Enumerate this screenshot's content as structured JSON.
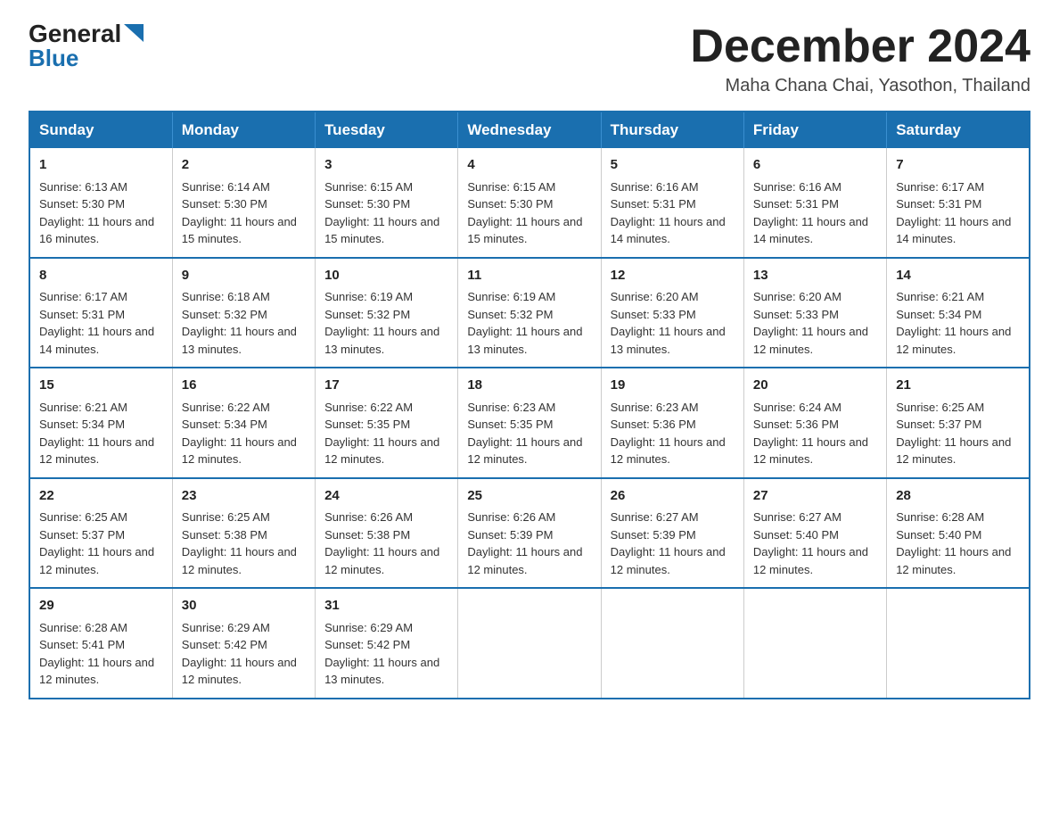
{
  "logo": {
    "general": "General",
    "blue": "Blue"
  },
  "title": "December 2024",
  "location": "Maha Chana Chai, Yasothon, Thailand",
  "days_header": [
    "Sunday",
    "Monday",
    "Tuesday",
    "Wednesday",
    "Thursday",
    "Friday",
    "Saturday"
  ],
  "weeks": [
    [
      {
        "day": "1",
        "sunrise": "6:13 AM",
        "sunset": "5:30 PM",
        "daylight": "11 hours and 16 minutes."
      },
      {
        "day": "2",
        "sunrise": "6:14 AM",
        "sunset": "5:30 PM",
        "daylight": "11 hours and 15 minutes."
      },
      {
        "day": "3",
        "sunrise": "6:15 AM",
        "sunset": "5:30 PM",
        "daylight": "11 hours and 15 minutes."
      },
      {
        "day": "4",
        "sunrise": "6:15 AM",
        "sunset": "5:30 PM",
        "daylight": "11 hours and 15 minutes."
      },
      {
        "day": "5",
        "sunrise": "6:16 AM",
        "sunset": "5:31 PM",
        "daylight": "11 hours and 14 minutes."
      },
      {
        "day": "6",
        "sunrise": "6:16 AM",
        "sunset": "5:31 PM",
        "daylight": "11 hours and 14 minutes."
      },
      {
        "day": "7",
        "sunrise": "6:17 AM",
        "sunset": "5:31 PM",
        "daylight": "11 hours and 14 minutes."
      }
    ],
    [
      {
        "day": "8",
        "sunrise": "6:17 AM",
        "sunset": "5:31 PM",
        "daylight": "11 hours and 14 minutes."
      },
      {
        "day": "9",
        "sunrise": "6:18 AM",
        "sunset": "5:32 PM",
        "daylight": "11 hours and 13 minutes."
      },
      {
        "day": "10",
        "sunrise": "6:19 AM",
        "sunset": "5:32 PM",
        "daylight": "11 hours and 13 minutes."
      },
      {
        "day": "11",
        "sunrise": "6:19 AM",
        "sunset": "5:32 PM",
        "daylight": "11 hours and 13 minutes."
      },
      {
        "day": "12",
        "sunrise": "6:20 AM",
        "sunset": "5:33 PM",
        "daylight": "11 hours and 13 minutes."
      },
      {
        "day": "13",
        "sunrise": "6:20 AM",
        "sunset": "5:33 PM",
        "daylight": "11 hours and 12 minutes."
      },
      {
        "day": "14",
        "sunrise": "6:21 AM",
        "sunset": "5:34 PM",
        "daylight": "11 hours and 12 minutes."
      }
    ],
    [
      {
        "day": "15",
        "sunrise": "6:21 AM",
        "sunset": "5:34 PM",
        "daylight": "11 hours and 12 minutes."
      },
      {
        "day": "16",
        "sunrise": "6:22 AM",
        "sunset": "5:34 PM",
        "daylight": "11 hours and 12 minutes."
      },
      {
        "day": "17",
        "sunrise": "6:22 AM",
        "sunset": "5:35 PM",
        "daylight": "11 hours and 12 minutes."
      },
      {
        "day": "18",
        "sunrise": "6:23 AM",
        "sunset": "5:35 PM",
        "daylight": "11 hours and 12 minutes."
      },
      {
        "day": "19",
        "sunrise": "6:23 AM",
        "sunset": "5:36 PM",
        "daylight": "11 hours and 12 minutes."
      },
      {
        "day": "20",
        "sunrise": "6:24 AM",
        "sunset": "5:36 PM",
        "daylight": "11 hours and 12 minutes."
      },
      {
        "day": "21",
        "sunrise": "6:25 AM",
        "sunset": "5:37 PM",
        "daylight": "11 hours and 12 minutes."
      }
    ],
    [
      {
        "day": "22",
        "sunrise": "6:25 AM",
        "sunset": "5:37 PM",
        "daylight": "11 hours and 12 minutes."
      },
      {
        "day": "23",
        "sunrise": "6:25 AM",
        "sunset": "5:38 PM",
        "daylight": "11 hours and 12 minutes."
      },
      {
        "day": "24",
        "sunrise": "6:26 AM",
        "sunset": "5:38 PM",
        "daylight": "11 hours and 12 minutes."
      },
      {
        "day": "25",
        "sunrise": "6:26 AM",
        "sunset": "5:39 PM",
        "daylight": "11 hours and 12 minutes."
      },
      {
        "day": "26",
        "sunrise": "6:27 AM",
        "sunset": "5:39 PM",
        "daylight": "11 hours and 12 minutes."
      },
      {
        "day": "27",
        "sunrise": "6:27 AM",
        "sunset": "5:40 PM",
        "daylight": "11 hours and 12 minutes."
      },
      {
        "day": "28",
        "sunrise": "6:28 AM",
        "sunset": "5:40 PM",
        "daylight": "11 hours and 12 minutes."
      }
    ],
    [
      {
        "day": "29",
        "sunrise": "6:28 AM",
        "sunset": "5:41 PM",
        "daylight": "11 hours and 12 minutes."
      },
      {
        "day": "30",
        "sunrise": "6:29 AM",
        "sunset": "5:42 PM",
        "daylight": "11 hours and 12 minutes."
      },
      {
        "day": "31",
        "sunrise": "6:29 AM",
        "sunset": "5:42 PM",
        "daylight": "11 hours and 13 minutes."
      },
      null,
      null,
      null,
      null
    ]
  ]
}
